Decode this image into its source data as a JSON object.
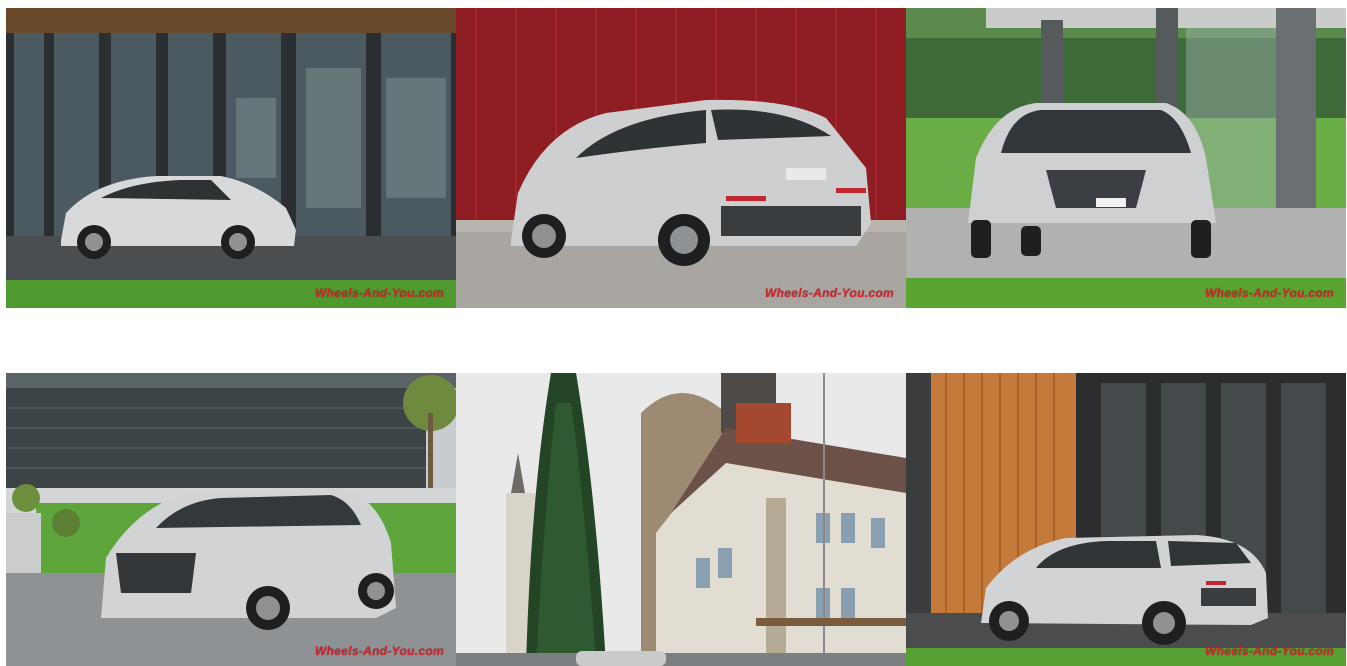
{
  "gallery": {
    "watermark": "Wheels-And-You.com",
    "photos": [
      {
        "name": "photo-suv-side-glass-building"
      },
      {
        "name": "photo-suv-rear-red-wall"
      },
      {
        "name": "photo-suv-front-pavilion"
      },
      {
        "name": "photo-suv-front-modern-building"
      },
      {
        "name": "photo-castle-church-street"
      },
      {
        "name": "photo-suv-rear-wood-facade"
      }
    ]
  },
  "colors": {
    "watermark": "#d9202a",
    "car_silver": "#c9cacc",
    "grass": "#5fae3a",
    "red_wall": "#8e1d24",
    "wood": "#c47a3a"
  }
}
